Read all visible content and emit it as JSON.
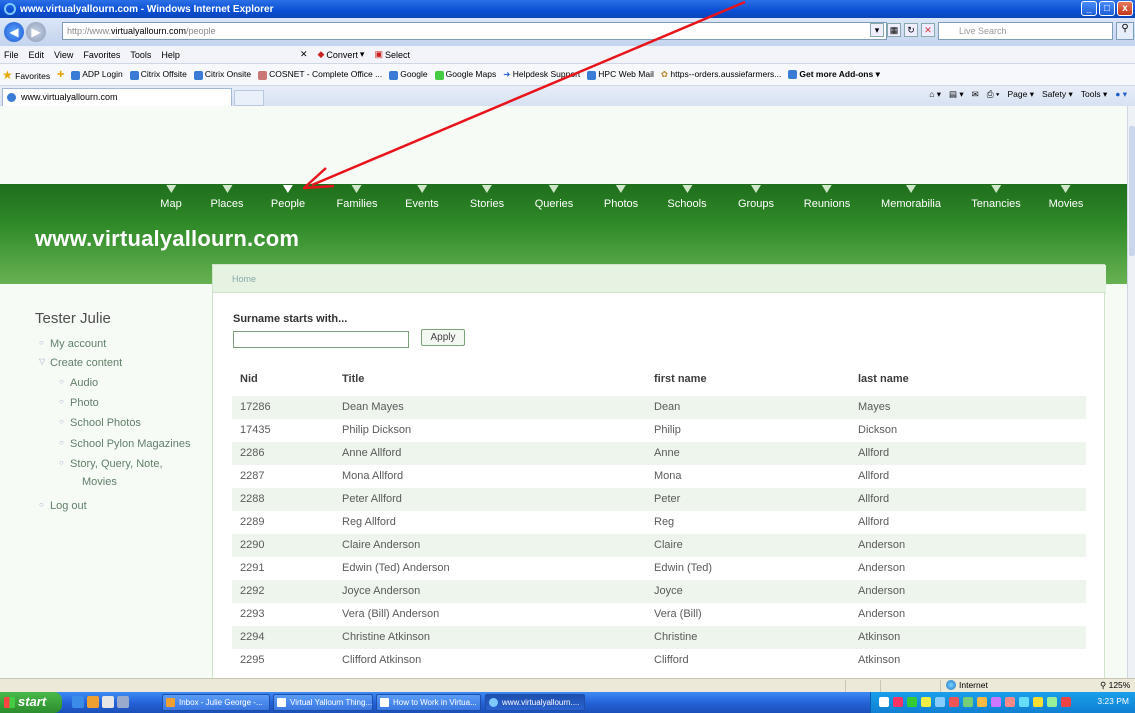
{
  "window": {
    "title": "www.virtualyallourn.com - Windows Internet Explorer",
    "min": "_",
    "max": "□",
    "close": "x"
  },
  "address": {
    "url_prefix": "http://www.",
    "url_domain": "virtualyallourn.com",
    "url_path": "/people",
    "search_placeholder": "Live Search"
  },
  "menu": {
    "items": [
      "File",
      "Edit",
      "View",
      "Favorites",
      "Tools",
      "Help"
    ],
    "convert": "Convert",
    "select": "Select"
  },
  "favorites": {
    "label": "Favorites",
    "items": [
      "ADP Login",
      "Citrix Offsite",
      "Citrix Onsite",
      "COSNET - Complete Office ...",
      "Google",
      "Google Maps",
      "Helpdesk Support",
      "HPC Web Mail",
      "https--orders.aussiefarmers...",
      "Get more Add-ons"
    ]
  },
  "tab": {
    "title": "www.virtualyallourn.com"
  },
  "commandbar": {
    "page": "Page",
    "safety": "Safety",
    "tools": "Tools"
  },
  "nav": {
    "items": [
      "Map",
      "Places",
      "People",
      "Families",
      "Events",
      "Stories",
      "Queries",
      "Photos",
      "Schools",
      "Groups",
      "Reunions",
      "Memorabilia",
      "Tenancies",
      "Movies"
    ],
    "active": "People"
  },
  "site": {
    "title": "www.virtualyallourn.com"
  },
  "breadcrumb": {
    "home": "Home"
  },
  "sidebar": {
    "user": "Tester Julie",
    "my_account": "My account",
    "create_content": "Create content",
    "sub": [
      "Audio",
      "Photo",
      "School Photos",
      "School Pylon Magazines",
      "Story, Query, Note,",
      "Movies"
    ],
    "log_out": "Log out"
  },
  "filter": {
    "label": "Surname starts with...",
    "value": "",
    "apply": "Apply"
  },
  "table": {
    "headers": [
      "Nid",
      "Title",
      "first name",
      "last name"
    ],
    "rows": [
      [
        "17286",
        "Dean Mayes",
        "Dean",
        "Mayes"
      ],
      [
        "17435",
        "Philip Dickson",
        "Philip",
        "Dickson"
      ],
      [
        "2286",
        "Anne Allford",
        "Anne",
        "Allford"
      ],
      [
        "2287",
        "Mona Allford",
        "Mona",
        "Allford"
      ],
      [
        "2288",
        "Peter Allford",
        "Peter",
        "Allford"
      ],
      [
        "2289",
        "Reg Allford",
        "Reg",
        "Allford"
      ],
      [
        "2290",
        "Claire Anderson",
        "Claire",
        "Anderson"
      ],
      [
        "2291",
        "Edwin (Ted) Anderson",
        "Edwin (Ted)",
        "Anderson"
      ],
      [
        "2292",
        "Joyce Anderson",
        "Joyce",
        "Anderson"
      ],
      [
        "2293",
        "Vera (Bill) Anderson",
        "Vera (Bill)",
        "Anderson"
      ],
      [
        "2294",
        "Christine Atkinson",
        "Christine",
        "Atkinson"
      ],
      [
        "2295",
        "Clifford Atkinson",
        "Clifford",
        "Atkinson"
      ]
    ]
  },
  "status": {
    "zone": "Internet",
    "zoom": "125%"
  },
  "taskbar": {
    "start": "start",
    "tasks": [
      "Inbox - Julie George -...",
      "Virtual Yallourn Thing...",
      "How to Work in Virtua...",
      "www.virtualyallourn...."
    ],
    "clock": "3:23 PM"
  },
  "colors": {
    "annotation_arrow": "#e8141c",
    "site_green": "#2f8a28",
    "xp_blue": "#2563d8"
  }
}
